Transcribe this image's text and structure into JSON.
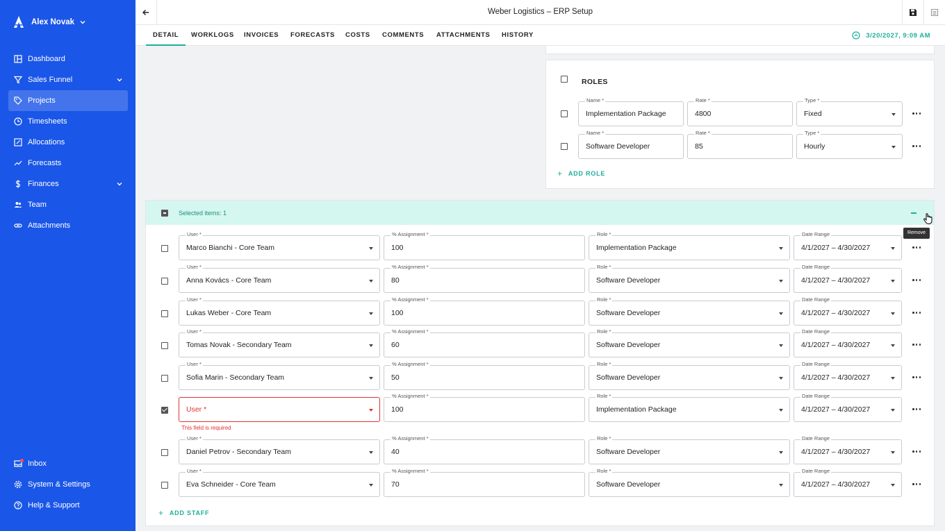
{
  "sidebar": {
    "user_name": "Alex Novak",
    "items": [
      {
        "label": "Dashboard",
        "icon": "dashboard-icon"
      },
      {
        "label": "Sales Funnel",
        "icon": "funnel-icon"
      },
      {
        "label": "Projects",
        "icon": "tag-icon",
        "active": true
      },
      {
        "label": "Timesheets",
        "icon": "clock-icon"
      },
      {
        "label": "Allocations",
        "icon": "edit-icon"
      },
      {
        "label": "Forecasts",
        "icon": "trend-icon"
      },
      {
        "label": "Finances",
        "icon": "dollar-icon"
      },
      {
        "label": "Team",
        "icon": "team-icon"
      },
      {
        "label": "Attachments",
        "icon": "paperclip-icon"
      }
    ],
    "bottom_items": [
      {
        "label": "Inbox",
        "icon": "inbox-icon"
      },
      {
        "label": "System & Settings",
        "icon": "gear-icon"
      },
      {
        "label": "Help & Support",
        "icon": "help-icon"
      }
    ]
  },
  "header": {
    "title": "Weber Logistics – ERP Setup",
    "tabs": [
      "DETAIL",
      "WORKLOGS",
      "INVOICES",
      "FORECASTS",
      "COSTS",
      "COMMENTS",
      "ATTACHMENTS",
      "HISTORY"
    ],
    "datetime": "3/20/2027, 9:09 AM"
  },
  "roles": {
    "title": "ROLES",
    "labels": {
      "name": "Name *",
      "rate": "Rate *",
      "type": "Type *"
    },
    "rows": [
      {
        "name": "Implementation Package",
        "rate": "4800",
        "type": "Fixed"
      },
      {
        "name": "Software Developer",
        "rate": "85",
        "type": "Hourly"
      }
    ],
    "add_label": "ADD ROLE"
  },
  "staff": {
    "selected_text": "Selected items: 1",
    "tooltip": "Remove",
    "labels": {
      "user": "User *",
      "assignment": "% Assignment *",
      "role": "Role *",
      "date": "Date Range"
    },
    "rows": [
      {
        "user": "Marco Bianchi - Core Team",
        "assignment": "100",
        "role": "Implementation Package",
        "date": "4/1/2027 – 4/30/2027",
        "checked": false
      },
      {
        "user": "Anna Kovács - Core Team",
        "assignment": "80",
        "role": "Software Developer",
        "date": "4/1/2027 – 4/30/2027",
        "checked": false
      },
      {
        "user": "Lukas Weber - Core Team",
        "assignment": "100",
        "role": "Software Developer",
        "date": "4/1/2027 – 4/30/2027",
        "checked": false
      },
      {
        "user": "Tomas Novak - Secondary Team",
        "assignment": "60",
        "role": "Software Developer",
        "date": "4/1/2027 – 4/30/2027",
        "checked": false
      },
      {
        "user": "Sofia Marin - Secondary Team",
        "assignment": "50",
        "role": "Software Developer",
        "date": "4/1/2027 – 4/30/2027",
        "checked": false
      },
      {
        "user": "",
        "user_placeholder": "User *",
        "error": "This field is required",
        "assignment": "100",
        "role": "Implementation Package",
        "date": "4/1/2027 – 4/30/2027",
        "checked": true
      },
      {
        "user": "Daniel Petrov - Secondary Team",
        "assignment": "40",
        "role": "Software Developer",
        "date": "4/1/2027 – 4/30/2027",
        "checked": false
      },
      {
        "user": "Eva Schneider - Core Team",
        "assignment": "70",
        "role": "Software Developer",
        "date": "4/1/2027 – 4/30/2027",
        "checked": false
      }
    ],
    "add_label": "ADD STAFF"
  },
  "colors": {
    "sidebar": "#1a56e8",
    "accent": "#1fae9b",
    "selection": "#d4f7ef",
    "error": "#e03131"
  }
}
